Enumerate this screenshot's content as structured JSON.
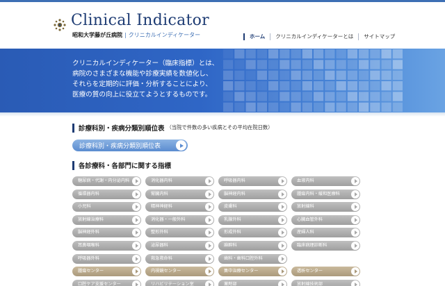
{
  "header": {
    "title": "Clinical Indicator",
    "org": "昭和大学藤が丘病院",
    "brand": "クリニカルインディケーター",
    "logo_icon": "hospital-emblem-icon"
  },
  "nav": [
    {
      "label": "ホーム"
    },
    {
      "label": "クリニカルインディケーターとは"
    },
    {
      "label": "サイトマップ"
    }
  ],
  "hero": {
    "lines": [
      "クリニカルインディケーター（臨床指標）とは、",
      "病院のさまざまな機能や診療実績を数値化し、",
      "それらを定期的に評価・分析することにより、",
      "医療の質の向上に役立てようとするものです。"
    ]
  },
  "section1": {
    "title": "診療科別・疾病分類別順位表",
    "note": "（当院で件数の多い疾病とその平均在院日数）",
    "button": "診療科別・疾病分類別順位表"
  },
  "section2": {
    "title": "各診療科・各部門に関する指標"
  },
  "departments": [
    {
      "label": "糖尿病・代謝・内分泌内科",
      "tone": "gray"
    },
    {
      "label": "消化器内科",
      "tone": "gray"
    },
    {
      "label": "呼吸器内科",
      "tone": "gray"
    },
    {
      "label": "血液内科",
      "tone": "gray"
    },
    {
      "label": "循環器内科",
      "tone": "gray"
    },
    {
      "label": "腎臓内科",
      "tone": "gray"
    },
    {
      "label": "脳神経内科",
      "tone": "gray"
    },
    {
      "label": "腫瘍内科・緩和医療科",
      "tone": "gray"
    },
    {
      "label": "小児科",
      "tone": "gray"
    },
    {
      "label": "精神神経科",
      "tone": "gray"
    },
    {
      "label": "皮膚科",
      "tone": "gray"
    },
    {
      "label": "放射線科",
      "tone": "gray"
    },
    {
      "label": "放射線治療科",
      "tone": "gray"
    },
    {
      "label": "消化器・一般外科",
      "tone": "gray"
    },
    {
      "label": "乳腺外科",
      "tone": "gray"
    },
    {
      "label": "心臓血管外科",
      "tone": "gray"
    },
    {
      "label": "脳神経外科",
      "tone": "gray"
    },
    {
      "label": "整形外科",
      "tone": "gray"
    },
    {
      "label": "形成外科",
      "tone": "gray"
    },
    {
      "label": "産婦人科",
      "tone": "gray"
    },
    {
      "label": "耳鼻咽喉科",
      "tone": "gray"
    },
    {
      "label": "泌尿器科",
      "tone": "gray"
    },
    {
      "label": "麻酔科",
      "tone": "gray"
    },
    {
      "label": "臨床病理診断科",
      "tone": "gray"
    },
    {
      "label": "呼吸器外科",
      "tone": "gray"
    },
    {
      "label": "救急救命科",
      "tone": "gray"
    },
    {
      "label": "歯科・歯科口腔外科",
      "tone": "gray"
    },
    {
      "label": "",
      "tone": "empty"
    },
    {
      "label": "腫瘍センター",
      "tone": "tan"
    },
    {
      "label": "内視鏡センター",
      "tone": "tan"
    },
    {
      "label": "集中治療センター",
      "tone": "tan"
    },
    {
      "label": "透析センター",
      "tone": "tan"
    },
    {
      "label": "口腔ケア支援センター",
      "tone": "gray"
    },
    {
      "label": "リハビリテーション室",
      "tone": "gray"
    },
    {
      "label": "薬剤部",
      "tone": "gray"
    },
    {
      "label": "放射線技術部",
      "tone": "gray"
    }
  ]
}
